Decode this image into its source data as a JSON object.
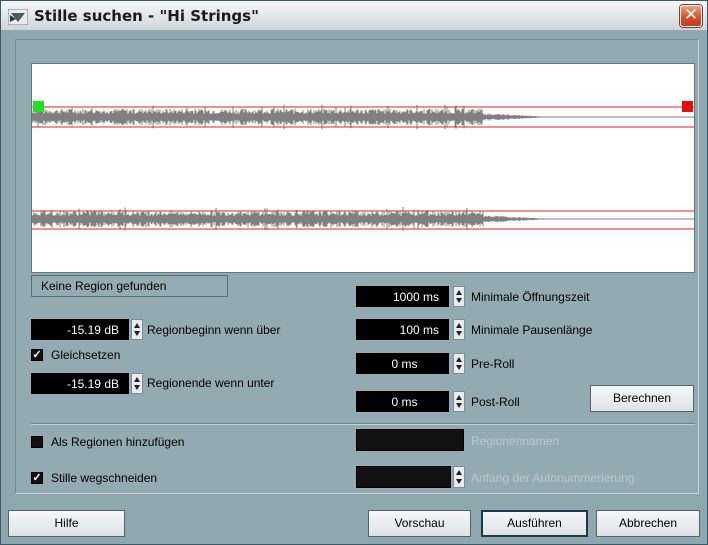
{
  "window": {
    "title": "Stille suchen - \"Hi Strings\"",
    "close_glyph": "✕"
  },
  "status": {
    "text": "Keine Region gefunden"
  },
  "left": {
    "region_start": {
      "value": "-15.19 dB",
      "label": "Regionbeginn wenn über"
    },
    "equalize": {
      "label": "Gleichsetzen",
      "checked": true
    },
    "region_end": {
      "value": "-15.19 dB",
      "label": "Regionende wenn unter"
    }
  },
  "right": {
    "min_open": {
      "value": "1000 ms",
      "label": "Minimale Öffnungszeit"
    },
    "min_pause": {
      "value": "100 ms",
      "label": "Minimale Pausenlänge"
    },
    "pre_roll": {
      "value": "0 ms",
      "label": "Pre-Roll"
    },
    "post_roll": {
      "value": "0 ms",
      "label": "Post-Roll"
    },
    "calc_button": "Berechnen"
  },
  "options": {
    "add_regions": {
      "label": "Als Regionen hinzufügen",
      "checked": false
    },
    "cut_silence": {
      "label": "Stille wegschneiden",
      "checked": true
    },
    "region_names": {
      "value": "",
      "label": "Regionennamen"
    },
    "auto_number": {
      "value": "",
      "label": "Anfang der Autonummerierung"
    }
  },
  "buttons": {
    "help": "Hilfe",
    "preview": "Vorschau",
    "execute": "Ausführen",
    "cancel": "Abbrechen"
  },
  "colors": {
    "threshold_line": "#e02020",
    "waveform": "#808080",
    "start_marker": "#22e022",
    "end_marker": "#e01010"
  }
}
